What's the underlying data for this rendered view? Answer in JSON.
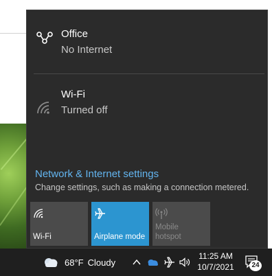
{
  "networks": [
    {
      "name": "Office",
      "status": "No Internet",
      "icon": "ethernet-icon"
    },
    {
      "name": "Wi-Fi",
      "status": "Turned off",
      "icon": "wifi-icon"
    }
  ],
  "settings": {
    "link": "Network & Internet settings",
    "description": "Change settings, such as making a connection metered."
  },
  "tiles": [
    {
      "label": "Wi-Fi",
      "state": "off",
      "icon": "wifi-icon"
    },
    {
      "label": "Airplane mode",
      "state": "on",
      "icon": "airplane-icon"
    },
    {
      "label_line1": "Mobile",
      "label_line2": "hotspot",
      "state": "disabled",
      "icon": "hotspot-icon"
    }
  ],
  "taskbar": {
    "weather": {
      "temp": "68°F",
      "condition": "Cloudy",
      "icon": "cloud-icon"
    },
    "clock": {
      "time": "11:25 AM",
      "date": "10/7/2021"
    },
    "notifications": {
      "count": "24"
    }
  },
  "colors": {
    "flyout_bg": "#2b2b2b",
    "accent": "#2c95d0",
    "link": "#63b5f0",
    "taskbar_bg": "#1f1f1f"
  }
}
